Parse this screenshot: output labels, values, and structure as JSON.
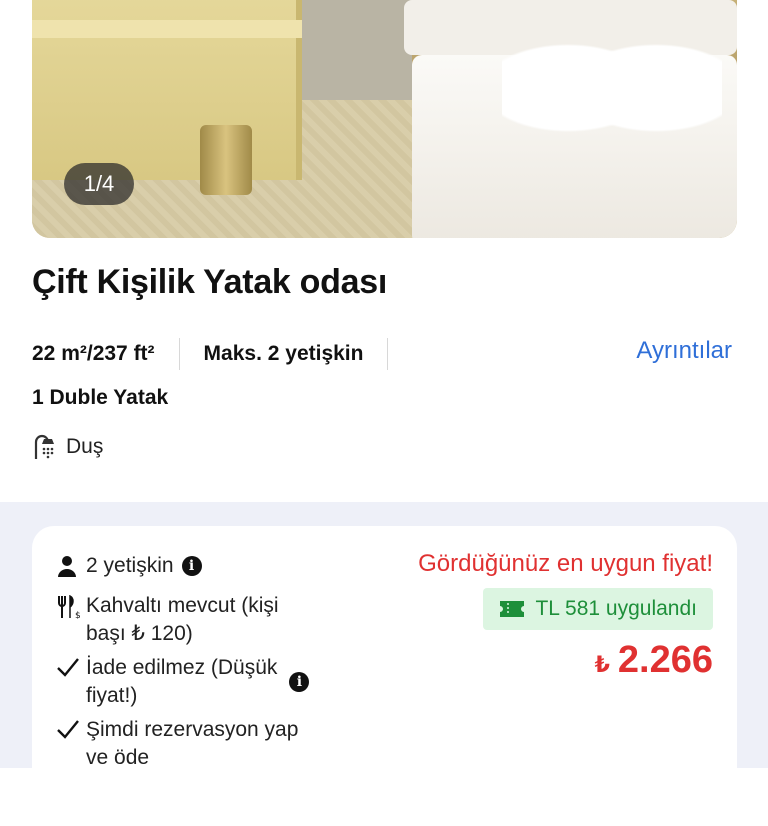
{
  "photo": {
    "counter": "1/4"
  },
  "room": {
    "title": "Çift Kişilik Yatak odası",
    "size": "22 m²/237 ft²",
    "capacity": "Maks. 2 yetişkin",
    "details_link": "Ayrıntılar",
    "bed": "1 Duble Yatak",
    "amenity": "Duş"
  },
  "offer": {
    "guests": "2 yetişkin",
    "breakfast_line1": "Kahvaltı mevcut (kişi",
    "breakfast_line2": "başı ₺ 120)",
    "refund_line1": "İade edilmez (Düşük",
    "refund_line2": "fiyat!)",
    "reserve_line1": "Şimdi rezervasyon yap",
    "reserve_line2": "ve öde",
    "best_price": "Gördüğünüz en uygun fiyat!",
    "discount": "TL 581 uygulandı",
    "currency": "₺",
    "price": "2.266"
  },
  "colors": {
    "accent_red": "#e03131",
    "link_blue": "#2f6fd8",
    "discount_green": "#1e8f3a",
    "discount_bg": "#dcf5e1",
    "section_bg": "#eef0f8"
  },
  "icons": [
    "shower-icon",
    "person-icon",
    "info-icon",
    "cutlery-icon",
    "check-icon",
    "ticket-icon"
  ]
}
